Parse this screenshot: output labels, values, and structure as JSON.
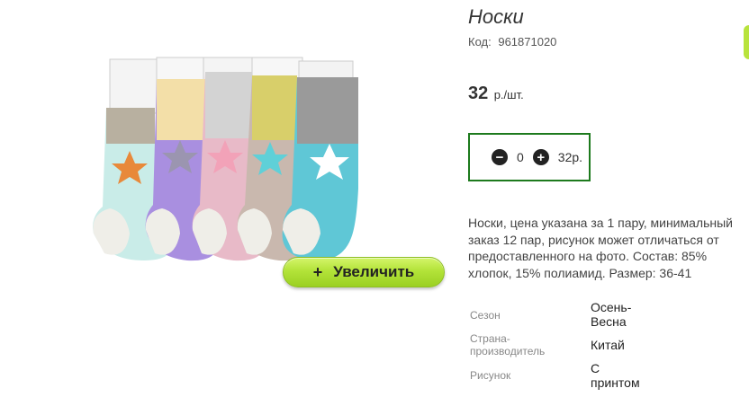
{
  "product": {
    "title": "Носки",
    "code_label": "Код:",
    "code_value": "961871020",
    "price_value": "32",
    "price_unit": "р./шт.",
    "zoom_plus": "+",
    "zoom_label": "Увеличить"
  },
  "quantity": {
    "minus_glyph": "−",
    "value": "0",
    "plus_glyph": "+",
    "sum": "32р."
  },
  "description": "Носки, цена указана за 1 пару, минимальный заказ 12 пар, рисунок может отличаться от предоставленного на фото. Состав: 85% хлопок, 15% полиамид. Размер: 36-41",
  "properties": [
    {
      "key": "Сезон",
      "value_line1": "Осень-",
      "value_line2": "Весна"
    },
    {
      "key_line1": "Страна-",
      "key_line2": "производитель",
      "value": "Китай"
    },
    {
      "key": "Рисунок",
      "value_line1": "С",
      "value_line2": "принтом"
    }
  ],
  "colors": {
    "accent_green": "#b3e339",
    "box_border": "#1d7a1d"
  }
}
